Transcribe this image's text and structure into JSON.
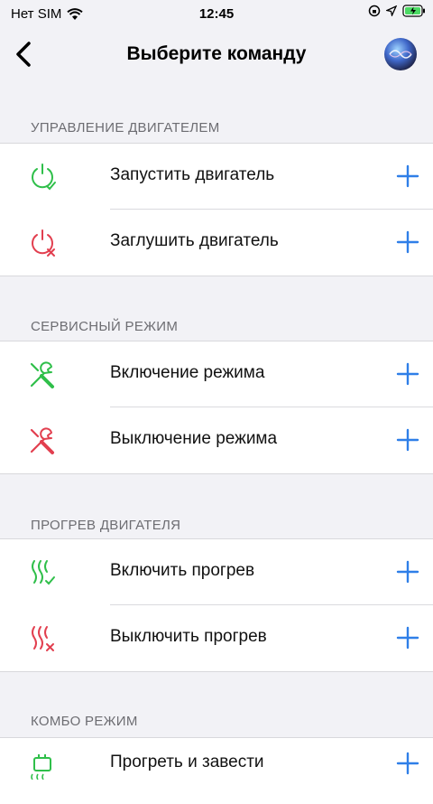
{
  "status_bar": {
    "carrier": "Нет SIM",
    "time": "12:45"
  },
  "nav": {
    "title": "Выберите команду"
  },
  "colors": {
    "green": "#2fbf4a",
    "red": "#e23f4f",
    "blue": "#2f7fe8"
  },
  "sections": [
    {
      "header": "УПРАВЛЕНИЕ ДВИГАТЕЛЕМ",
      "items": [
        {
          "label": "Запустить двигатель",
          "icon": "power-check-icon"
        },
        {
          "label": "Заглушить двигатель",
          "icon": "power-cross-icon"
        }
      ]
    },
    {
      "header": "СЕРВИСНЫЙ РЕЖИМ",
      "items": [
        {
          "label": "Включение режима",
          "icon": "tools-icon"
        },
        {
          "label": "Выключение режима",
          "icon": "tools-icon"
        }
      ]
    },
    {
      "header": "ПРОГРЕВ ДВИГАТЕЛЯ",
      "items": [
        {
          "label": "Включить прогрев",
          "icon": "heat-check-icon"
        },
        {
          "label": "Выключить прогрев",
          "icon": "heat-cross-icon"
        }
      ]
    },
    {
      "header": "КОМБО РЕЖИМ",
      "items": [
        {
          "label": "Прогреть и завести",
          "icon": "engine-heat-icon"
        }
      ]
    }
  ]
}
